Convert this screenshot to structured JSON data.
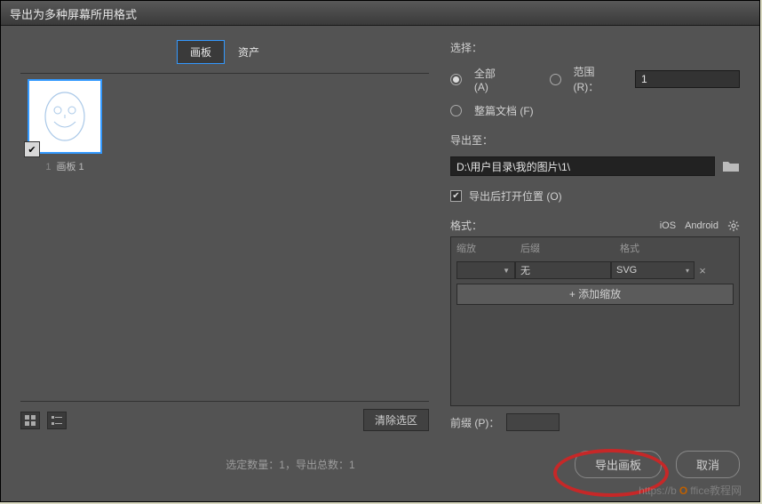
{
  "window": {
    "title": "导出为多种屏幕所用格式"
  },
  "tabs": {
    "artboards": "画板",
    "assets": "资产"
  },
  "artboards": [
    {
      "index": "1",
      "name": "画板 1",
      "checked": true
    }
  ],
  "left_bottom": {
    "clear_selection": "清除选区"
  },
  "selection": {
    "label": "选择：",
    "all_label": "全部 (A)",
    "range_label": "范围 (R)：",
    "range_value": "1",
    "whole_doc_label": "整篇文档 (F)",
    "selected_option": "all"
  },
  "export_to": {
    "label": "导出至：",
    "path": "D:\\用户目录\\我的图片\\1\\"
  },
  "open_after": {
    "label": "导出后打开位置 (O)",
    "checked": true
  },
  "format": {
    "label": "格式：",
    "ios": "iOS",
    "android": "Android",
    "head_scale": "缩放",
    "head_suffix": "后缀",
    "head_format": "格式",
    "rows": [
      {
        "scale": "",
        "suffix": "无",
        "format": "SVG"
      }
    ],
    "add_scale": "+ 添加缩放"
  },
  "prefix": {
    "label": "前缀 (P)：",
    "value": ""
  },
  "footer": {
    "counts": "选定数量：1，导出总数：1",
    "export_btn": "导出画板",
    "cancel_btn": "取消"
  },
  "watermark": "ffice教程网"
}
